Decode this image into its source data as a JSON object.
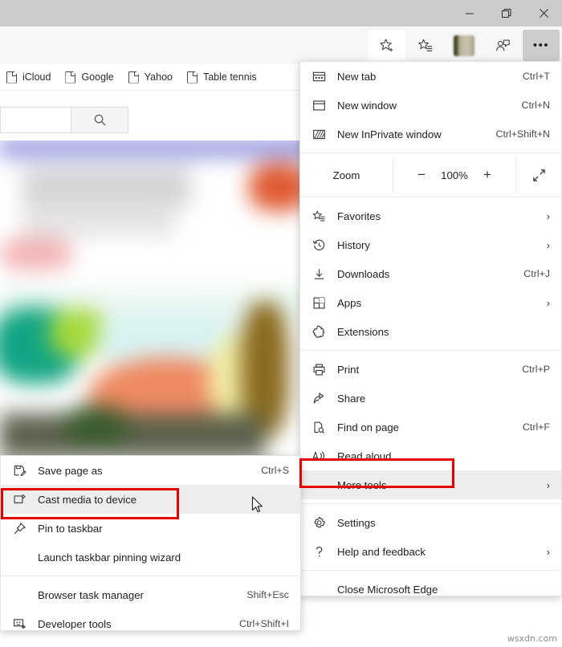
{
  "window": {
    "controls": [
      {
        "name": "minimize",
        "glyph": "─"
      },
      {
        "name": "restore",
        "glyph": "❐"
      },
      {
        "name": "close",
        "glyph": "✕"
      }
    ],
    "titlebar_color": "#cccccc"
  },
  "toolbar": {
    "buttons": [
      {
        "name": "favorite-star-icon",
        "glyph": ""
      },
      {
        "name": "favorites-list-icon",
        "glyph": ""
      },
      {
        "name": "profile-avatar",
        "glyph": ""
      },
      {
        "name": "collections-icon",
        "glyph": ""
      },
      {
        "name": "settings-and-more-icon",
        "glyph": "•••"
      }
    ]
  },
  "bookmarks_bar": {
    "items": [
      {
        "label": "iCloud",
        "icon": "page-icon"
      },
      {
        "label": "Google",
        "icon": "page-icon"
      },
      {
        "label": "Yahoo",
        "icon": "page-icon"
      },
      {
        "label": "Table tennis",
        "icon": "page-icon"
      }
    ]
  },
  "page": {
    "search": {
      "value": "",
      "placeholder": "",
      "button_icon": "search-icon"
    }
  },
  "main_menu": {
    "groups": [
      {
        "items": [
          {
            "label": "New tab",
            "accel": "Ctrl+T",
            "icon": "new-tab-icon",
            "chevron": false
          },
          {
            "label": "New window",
            "accel": "Ctrl+N",
            "icon": "new-window-icon",
            "chevron": false
          },
          {
            "label": "New InPrivate window",
            "accel": "Ctrl+Shift+N",
            "icon": "inprivate-icon",
            "chevron": false
          }
        ]
      },
      {
        "zoom": {
          "label": "Zoom",
          "minus": "−",
          "value": "100%",
          "plus": "+",
          "fullscreen_icon": "fullscreen-icon"
        }
      },
      {
        "items": [
          {
            "label": "Favorites",
            "accel": "",
            "icon": "favorites-icon",
            "chevron": true
          },
          {
            "label": "History",
            "accel": "",
            "icon": "history-icon",
            "chevron": true
          },
          {
            "label": "Downloads",
            "accel": "Ctrl+J",
            "icon": "downloads-icon",
            "chevron": false
          },
          {
            "label": "Apps",
            "accel": "",
            "icon": "apps-icon",
            "chevron": true
          },
          {
            "label": "Extensions",
            "accel": "",
            "icon": "extensions-icon",
            "chevron": false
          }
        ]
      },
      {
        "items": [
          {
            "label": "Print",
            "accel": "Ctrl+P",
            "icon": "print-icon",
            "chevron": false
          },
          {
            "label": "Share",
            "accel": "",
            "icon": "share-icon",
            "chevron": false
          },
          {
            "label": "Find on page",
            "accel": "Ctrl+F",
            "icon": "find-icon",
            "chevron": false
          },
          {
            "label": "Read aloud",
            "accel": "",
            "icon": "read-aloud-icon",
            "chevron": false
          },
          {
            "label": "More tools",
            "accel": "",
            "icon": "none",
            "chevron": true,
            "highlighted": true
          }
        ]
      },
      {
        "items": [
          {
            "label": "Settings",
            "accel": "",
            "icon": "gear-icon",
            "chevron": false
          },
          {
            "label": "Help and feedback",
            "accel": "",
            "icon": "question-icon",
            "chevron": true
          }
        ]
      },
      {
        "items": [
          {
            "label": "Close Microsoft Edge",
            "accel": "",
            "icon": "none",
            "chevron": false
          }
        ]
      }
    ]
  },
  "sub_menu": {
    "groups": [
      {
        "items": [
          {
            "label": "Save page as",
            "accel": "Ctrl+S",
            "icon": "save-page-icon",
            "chevron": false
          },
          {
            "label": "Cast media to device",
            "accel": "",
            "icon": "cast-icon",
            "chevron": false,
            "highlighted": true
          },
          {
            "label": "Pin to taskbar",
            "accel": "",
            "icon": "pin-icon",
            "chevron": false
          },
          {
            "label": "Launch taskbar pinning wizard",
            "accel": "",
            "icon": "none",
            "chevron": false
          }
        ]
      },
      {
        "items": [
          {
            "label": "Browser task manager",
            "accel": "Shift+Esc",
            "icon": "none",
            "chevron": false
          },
          {
            "label": "Developer tools",
            "accel": "Ctrl+Shift+I",
            "icon": "devtools-icon",
            "chevron": false
          }
        ]
      }
    ]
  },
  "annotations": {
    "highlight_color": "#e60000",
    "boxes": [
      {
        "name": "more-tools-highlight",
        "target": "More tools"
      },
      {
        "name": "cast-media-highlight",
        "target": "Cast media to device"
      }
    ]
  },
  "watermark": {
    "text": "wsxdn.com"
  }
}
